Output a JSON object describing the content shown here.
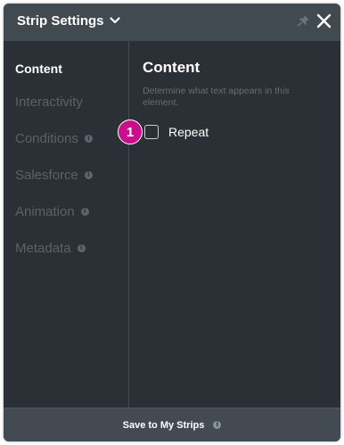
{
  "header": {
    "title": "Strip Settings",
    "chevron_icon": "chevron-down-icon",
    "pin_icon": "pin-icon",
    "close_icon": "close-icon"
  },
  "sidebar": {
    "items": [
      {
        "label": "Content",
        "active": true,
        "info": false
      },
      {
        "label": "Interactivity",
        "active": false,
        "info": false
      },
      {
        "label": "Conditions",
        "active": false,
        "info": true
      },
      {
        "label": "Salesforce",
        "active": false,
        "info": true
      },
      {
        "label": "Animation",
        "active": false,
        "info": true
      },
      {
        "label": "Metadata",
        "active": false,
        "info": true
      }
    ]
  },
  "main": {
    "title": "Content",
    "description": "Determine what text appears in this element.",
    "badge": "1",
    "repeat": {
      "label": "Repeat",
      "checked": false
    }
  },
  "footer": {
    "save_label": "Save to My Strips",
    "info_icon": "info-icon"
  },
  "colors": {
    "panel_bg": "#2a3035",
    "header_bg": "#424a51",
    "badge_bg": "#c80f8c",
    "muted_text": "#5a6268"
  }
}
